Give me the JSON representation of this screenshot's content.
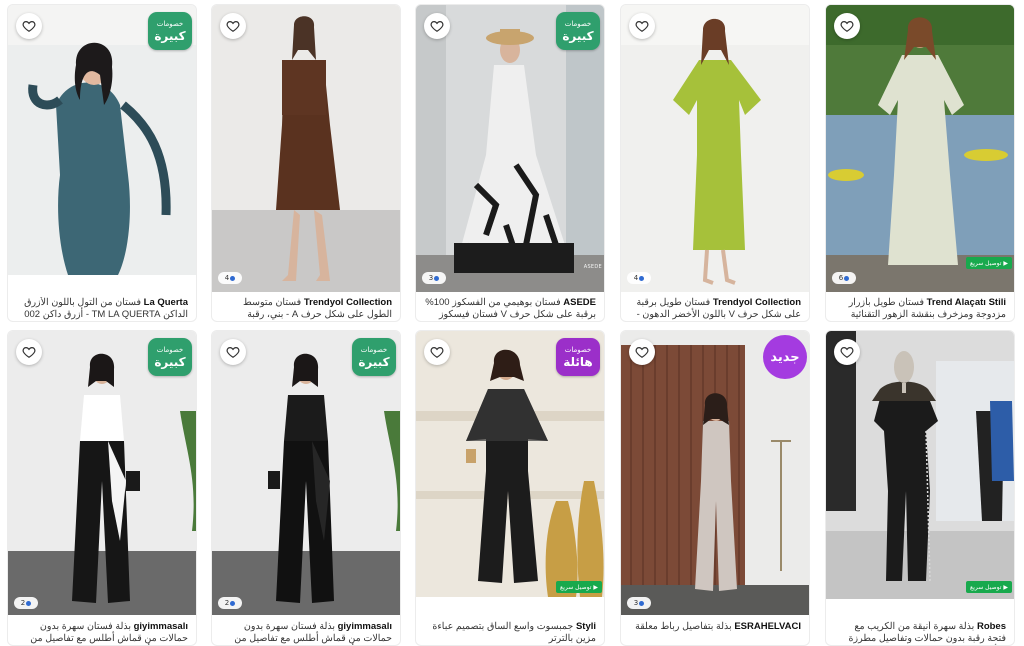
{
  "badges": {
    "discount_line1": "خصومات",
    "discount_big": "كبيرة",
    "discount_amazing": "هائلة",
    "new_label": "جديد",
    "fast_shipping": "توصيل سريع"
  },
  "colors": {
    "discount_green": "#2f9f6d",
    "discount_purple": "#9b2fc9",
    "new_purple": "#a43be0",
    "ship_green": "#18a94d"
  },
  "products": [
    {
      "brand": "La Querta",
      "title": "فستان من التول باللون الأزرق الداكن TM LA QUERTA - أزرق داكن 002",
      "photo_count": "",
      "badge": "discount-big",
      "fast_shipping": false,
      "icon": "heart-icon"
    },
    {
      "brand": "Trendyol Collection",
      "title": "فستان متوسط الطول على شكل حرف A - بني، رقبة واسعة، كريب منسوج...",
      "photo_count": "4",
      "badge": "",
      "fast_shipping": false,
      "icon": "heart-icon"
    },
    {
      "brand": "ASEDE",
      "title": "فستان بوهيمي من الفسكوز 100% برقبة على شكل حرف V فستان فيسكوز مطبوع عرقيا...",
      "photo_count": "3",
      "badge": "discount-big",
      "fast_shipping": false,
      "image_logo": "ASEDE",
      "icon": "heart-icon"
    },
    {
      "brand": "Trendyol Collection",
      "title": "فستان طويل برقبة على شكل حرف V باللون الأخضر الدهون - على شكل...",
      "photo_count": "4",
      "badge": "",
      "fast_shipping": false,
      "icon": "heart-icon"
    },
    {
      "brand": "Trend Alaçatı Stili",
      "title": "فستان طويل بأزرار مزدوجة ومزخرف بنقشة الزهور التقنائية للسيدات -ALC...",
      "photo_count": "6",
      "badge": "",
      "fast_shipping": true,
      "icon": "heart-icon"
    },
    {
      "brand": "giyimmasalı",
      "title": "بذلة فستان سهرة بدون حمالات من قماش أطلس مع تفاصيل من الساتان - أبيض/...",
      "photo_count": "2",
      "badge": "discount-big",
      "fast_shipping": false,
      "icon": "heart-icon"
    },
    {
      "brand": "giyimmasalı",
      "title": "بذلة فستان سهرة بدون حمالات من قماش أطلس مع تفاصيل من الساتان - أسود",
      "photo_count": "2",
      "badge": "discount-big",
      "fast_shipping": false,
      "icon": "heart-icon"
    },
    {
      "brand": "Styli",
      "title": "جمبسوت واسع الساق بتصميم عباءة مزين بالترتر",
      "photo_count": "",
      "badge": "discount-amazing",
      "fast_shipping": true,
      "icon": "heart-icon"
    },
    {
      "brand": "ESRAHELVACI",
      "title": "بذلة بتفاصيل رباط معلقة",
      "photo_count": "3",
      "badge": "new",
      "fast_shipping": false,
      "icon": "heart-icon"
    },
    {
      "brand": "Robes",
      "title": "بذلة سهرة أنيقة من الكريب مع فتحة رقبة بدون حمالات وتفاصيل مطرزة بالأحجار والريش",
      "photo_count": "",
      "badge": "",
      "fast_shipping": true,
      "icon": "heart-icon"
    }
  ]
}
